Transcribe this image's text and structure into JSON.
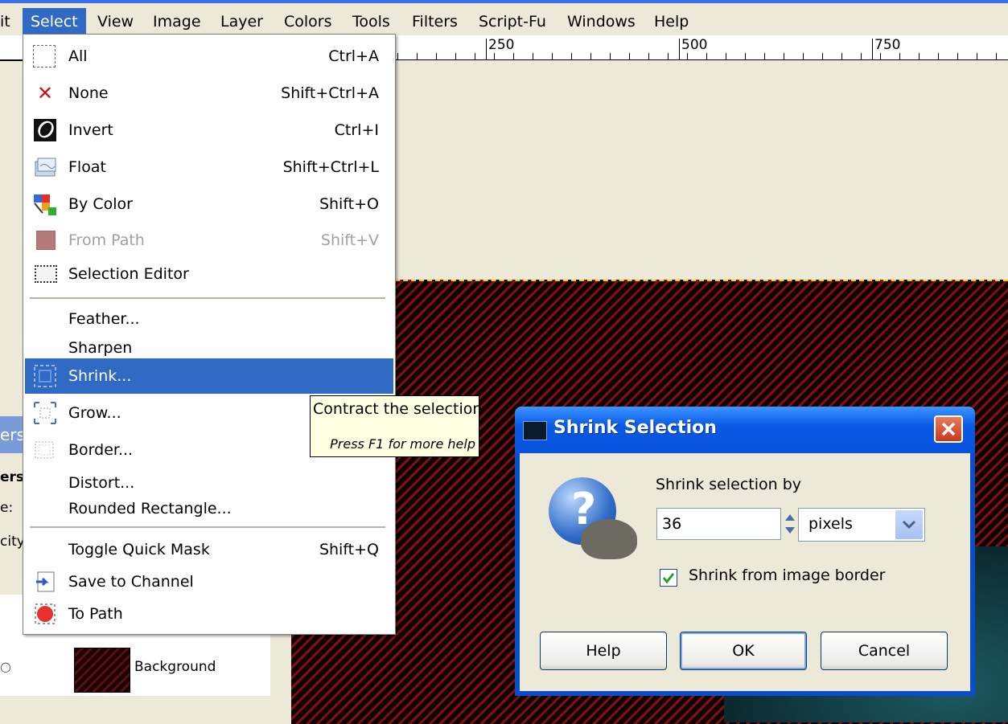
{
  "menubar": {
    "items": [
      {
        "label": "it"
      },
      {
        "label": "Select",
        "active": true
      },
      {
        "label": "View"
      },
      {
        "label": "Image"
      },
      {
        "label": "Layer"
      },
      {
        "label": "Colors"
      },
      {
        "label": "Tools"
      },
      {
        "label": "Filters"
      },
      {
        "label": "Script-Fu"
      },
      {
        "label": "Windows"
      },
      {
        "label": "Help"
      }
    ]
  },
  "ruler": {
    "labels": [
      "250",
      "500",
      "750"
    ]
  },
  "select_menu": {
    "items": [
      {
        "label": "All",
        "shortcut": "Ctrl+A",
        "icon": "select-all-icon"
      },
      {
        "label": "None",
        "shortcut": "Shift+Ctrl+A",
        "icon": "select-none-icon"
      },
      {
        "label": "Invert",
        "shortcut": "Ctrl+I",
        "icon": "invert-icon"
      },
      {
        "label": "Float",
        "shortcut": "Shift+Ctrl+L",
        "icon": "float-icon"
      },
      {
        "label": "By Color",
        "shortcut": "Shift+O",
        "icon": "by-color-icon"
      },
      {
        "label": "From Path",
        "shortcut": "Shift+V",
        "icon": "from-path-icon",
        "disabled": true
      },
      {
        "label": "Selection Editor",
        "shortcut": "",
        "icon": "selection-editor-icon"
      },
      {
        "label": "Feather...",
        "shortcut": ""
      },
      {
        "label": "Sharpen",
        "shortcut": ""
      },
      {
        "label": "Shrink...",
        "shortcut": "",
        "icon": "shrink-icon",
        "highlighted": true
      },
      {
        "label": "Grow...",
        "shortcut": "",
        "icon": "grow-icon"
      },
      {
        "label": "Border...",
        "shortcut": "",
        "icon": "border-icon"
      },
      {
        "label": "Distort...",
        "shortcut": ""
      },
      {
        "label": "Rounded Rectangle...",
        "shortcut": ""
      },
      {
        "label": "Toggle Quick Mask",
        "shortcut": "Shift+Q"
      },
      {
        "label": "Save to Channel",
        "shortcut": "",
        "icon": "save-channel-icon"
      },
      {
        "label": "To Path",
        "shortcut": "",
        "icon": "to-path-icon"
      }
    ]
  },
  "tooltip": {
    "text": "Contract the selection",
    "help": "Press F1 for more help"
  },
  "left_panel": {
    "tab_label": "ers",
    "labels": [
      "ers",
      "e:",
      "city"
    ],
    "layer_name": "Background"
  },
  "dialog": {
    "title": "Shrink Selection",
    "prompt": "Shrink selection by",
    "value": "36",
    "unit": "pixels",
    "checkbox_label": "Shrink from image border",
    "checkbox_checked": true,
    "buttons": {
      "help": "Help",
      "ok": "OK",
      "cancel": "Cancel"
    }
  },
  "colors": {
    "menu_highlight": "#316ac5",
    "titlebar": "#0a5ae6",
    "image_stripe_dark": "#120202",
    "image_stripe_red": "#7a1414"
  }
}
